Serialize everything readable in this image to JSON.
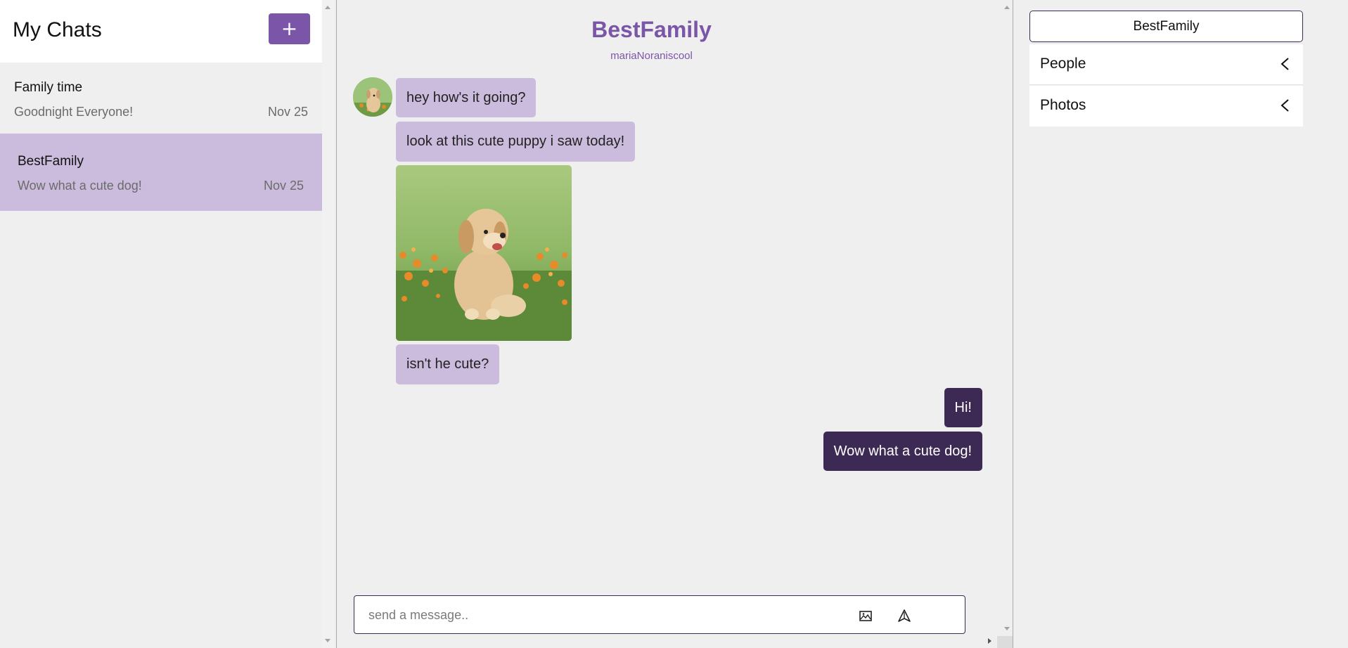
{
  "sidebar": {
    "title": "My Chats",
    "new_chat_label": "+",
    "chats": [
      {
        "name": "Family time",
        "preview": "Goodnight Everyone!",
        "date": "Nov 25",
        "selected": false
      },
      {
        "name": "BestFamily",
        "preview": "Wow what a cute dog!",
        "date": "Nov 25",
        "selected": true
      }
    ]
  },
  "chat": {
    "title": "BestFamily",
    "subtitle": "mariaNoraniscool",
    "messages": [
      {
        "direction": "in",
        "type": "text",
        "text": "hey how's it going?"
      },
      {
        "direction": "in",
        "type": "text",
        "text": "look at this cute puppy i saw today!"
      },
      {
        "direction": "in",
        "type": "image",
        "icon": "puppy-photo"
      },
      {
        "direction": "in",
        "type": "text",
        "text": "isn't he cute?"
      },
      {
        "direction": "out",
        "type": "text",
        "text": "Hi!"
      },
      {
        "direction": "out",
        "type": "text",
        "text": "Wow what a cute dog!"
      }
    ],
    "composer": {
      "placeholder": "send a message..",
      "value": "",
      "image_icon": "image-icon",
      "send_icon": "send-icon"
    }
  },
  "details": {
    "group_name": "BestFamily",
    "sections": [
      {
        "label": "People",
        "icon": "chevron-left-icon"
      },
      {
        "label": "Photos",
        "icon": "chevron-left-icon"
      }
    ]
  },
  "colors": {
    "accent": "#7b56a8",
    "incoming_bubble": "#cbbcdd",
    "outgoing_bubble": "#3c2a55",
    "selected_chat": "#cbbcdd",
    "background": "#efefef"
  }
}
